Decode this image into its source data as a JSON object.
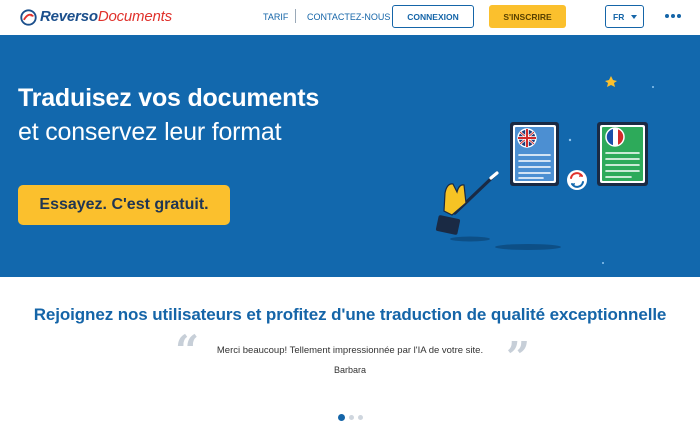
{
  "header": {
    "logo_reverso": "Reverso",
    "logo_documents": "Documents",
    "nav": {
      "tarif": "TARIF",
      "contact": "CONTACTEZ-NOUS"
    },
    "login_label": "CONNEXION",
    "signup_label": "S'INSCRIRE",
    "language": "FR",
    "more_icon": "more-horizontal-icon"
  },
  "hero": {
    "title": "Traduisez vos documents",
    "subtitle": "et conservez leur format",
    "cta_label": "Essayez. C'est gratuit.",
    "illustration_icons": [
      "magic-wand-icon",
      "document-uk-flag-icon",
      "swap-arrows-icon",
      "document-france-flag-icon"
    ]
  },
  "testimonials": {
    "title": "Rejoignez nos utilisateurs et profitez d'une traduction de qualité exceptionnelle",
    "open_quote": "“",
    "close_quote": "”",
    "quote": "Merci beaucoup! Tellement impressionnée par l'IA de votre site.",
    "author": "Barbara",
    "carousel_pages": 3,
    "carousel_active": 1
  },
  "colors": {
    "brand_blue": "#1565a8",
    "hero_blue": "#1268ad",
    "accent_yellow": "#fbc02d",
    "logo_red": "#e0322c"
  }
}
